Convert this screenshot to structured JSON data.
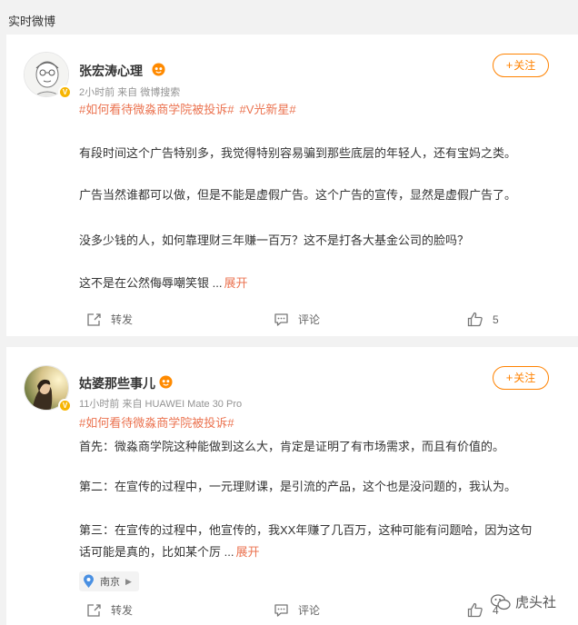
{
  "section": {
    "title": "实时微博"
  },
  "posts": [
    {
      "author": "张宏涛心理",
      "meta": "2小时前  来自 微博搜索",
      "follow_label": "关注",
      "tags": [
        "#如何看待微淼商学院被投诉#",
        "#V光新星#"
      ],
      "paragraphs": [
        "有段时间这个广告特别多，我觉得特别容易骗到那些底层的年轻人，还有宝妈之类。",
        "广告当然谁都可以做，但是不能是虚假广告。这个广告的宣传，显然是虚假广告了。",
        "没多少钱的人，如何靠理财三年赚一百万？这不是打各大基金公司的脸吗？",
        "这不是在公然侮辱嘲笑银 ..."
      ],
      "expand_label": "展开",
      "actions": {
        "repost": "转发",
        "comment": "评论",
        "like_count": "5"
      }
    },
    {
      "author": "姑婆那些事儿",
      "meta": "11小时前  来自 HUAWEI Mate 30 Pro",
      "follow_label": "关注",
      "tags": [
        "#如何看待微淼商学院被投诉#"
      ],
      "paragraphs": [
        "首先：微淼商学院这种能做到这么大，肯定是证明了有市场需求，而且有价值的。",
        "第二：在宣传的过程中，一元理财课，是引流的产品，这个也是没问题的，我认为。",
        "第三：在宣传的过程中，他宣传的，我XX年赚了几百万，这种可能有问题哈，因为这句",
        "话可能是真的，比如某个厉 ..."
      ],
      "expand_label": "展开",
      "location": "南京",
      "actions": {
        "repost": "转发",
        "comment": "评论",
        "like_count": "4"
      }
    }
  ],
  "watermark": "虎头社",
  "colors": {
    "accent": "#ff8200",
    "link": "#eb7350",
    "badge": "#f7b500"
  }
}
